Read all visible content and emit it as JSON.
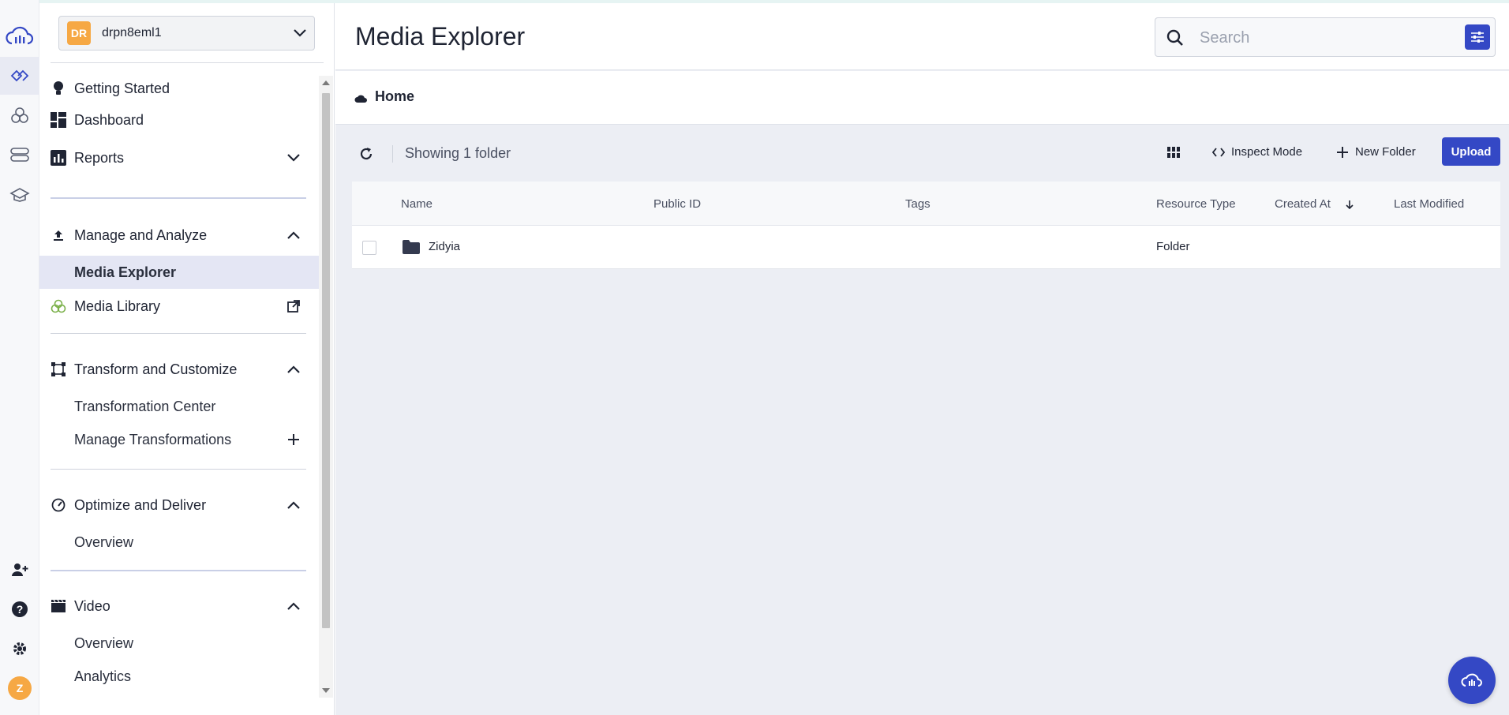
{
  "account": {
    "initials": "DR",
    "name": "drpn8eml1"
  },
  "sidebar": {
    "items": [
      {
        "label": "Getting Started"
      },
      {
        "label": "Dashboard"
      },
      {
        "label": "Reports"
      },
      {
        "label": "Manage and Analyze"
      },
      {
        "label": "Media Explorer"
      },
      {
        "label": "Media Library"
      },
      {
        "label": "Transform and Customize"
      },
      {
        "label": "Transformation Center"
      },
      {
        "label": "Manage Transformations"
      },
      {
        "label": "Optimize and Deliver"
      },
      {
        "label": "Overview"
      },
      {
        "label": "Video"
      },
      {
        "label": "Overview"
      },
      {
        "label": "Analytics"
      }
    ]
  },
  "rail": {
    "user_initial": "Z"
  },
  "header": {
    "title": "Media Explorer",
    "search_placeholder": "Search"
  },
  "breadcrumb": {
    "current": "Home"
  },
  "toolbar": {
    "count_text": "Showing 1 folder",
    "inspect_label": "Inspect Mode",
    "new_folder_label": "New Folder",
    "upload_label": "Upload"
  },
  "table": {
    "columns": [
      "Name",
      "Public ID",
      "Tags",
      "Resource Type",
      "Created At",
      "Last Modified"
    ],
    "rows": [
      {
        "name": "Zidyia",
        "public_id": "",
        "tags": "",
        "resource_type": "Folder",
        "created_at": "",
        "last_modified": ""
      }
    ]
  },
  "colors": {
    "accent": "#3448c5",
    "avatar": "#f6a844",
    "selected_bg": "#e4e6f4"
  }
}
